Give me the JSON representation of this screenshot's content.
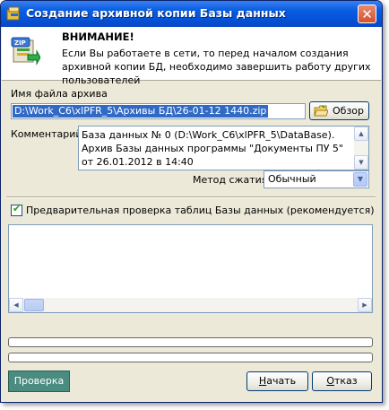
{
  "window": {
    "title": "Создание архивной копии Базы данных",
    "close_label": "✕"
  },
  "header": {
    "warning_title": "ВНИМАНИЕ!",
    "warning_text": "Если Вы работаете в сети, то перед началом создания архивной копии БД, необходимо завершить работу других пользователей"
  },
  "archive": {
    "file_label": "Имя файла архива",
    "file_value": "D:\\Work_C6\\xlPFR_5\\Архивы БД\\26-01-12 1440.zip",
    "browse_label": "Обзор"
  },
  "comment": {
    "label": "Комментарий:",
    "value": "База данных № 0 (D:\\Work_C6\\xlPFR_5\\DataBase). Архив Базы данных программы \"Документы ПУ 5\" от 26.01.2012 в 14:40"
  },
  "compression": {
    "label": "Метод сжатия:",
    "value": "Обычный"
  },
  "precheck": {
    "checked": true,
    "label": "Предварительная проверка таблиц Базы данных (рекомендуется)"
  },
  "buttons": {
    "check_label": "Проверка",
    "start_label_u": "Н",
    "start_label_rest": "ачать",
    "cancel_label_u": "О",
    "cancel_label_rest": "тказ"
  },
  "colors": {
    "title_bar": "#0452d8",
    "selection": "#316ac5",
    "check_button": "#4a8c80",
    "dialog_bg": "#ece9d8"
  }
}
